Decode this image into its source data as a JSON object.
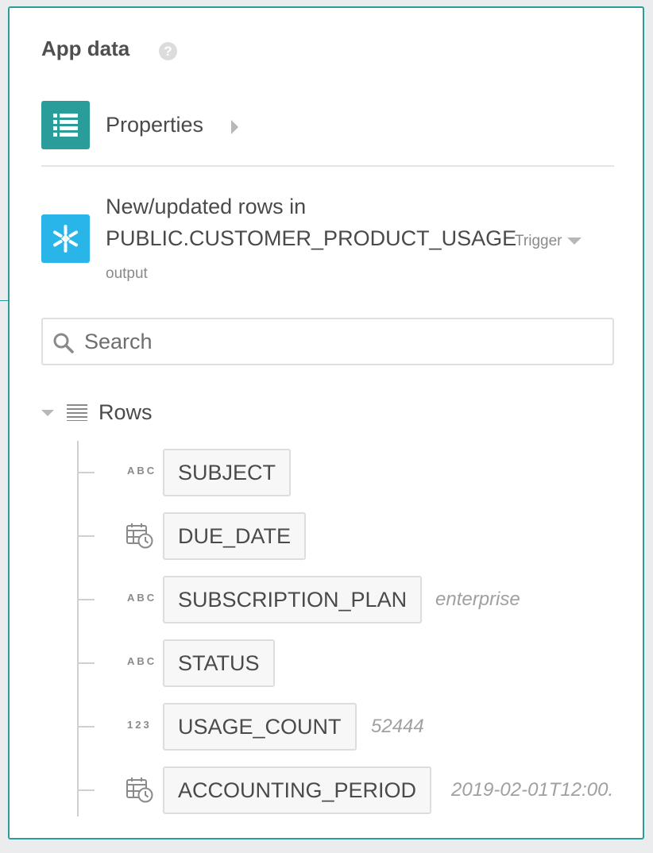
{
  "panel": {
    "title": "App data",
    "help_icon": "question-circle-icon"
  },
  "properties": {
    "icon": "list-icon",
    "label": "Properties",
    "caret_icon": "caret-right-icon"
  },
  "trigger_step": {
    "icon": "snowflake-icon",
    "line1": "New/updated rows in",
    "line2": "PUBLIC.CUSTOMER_PRODUCT_USAGE",
    "badge": "Trigger",
    "badge_icon": "caret-down-icon",
    "sublabel": "output"
  },
  "search": {
    "placeholder": "Search",
    "value": "",
    "icon": "search-icon"
  },
  "rows_group": {
    "label": "Rows",
    "toggle_icon": "caret-down-icon",
    "icon": "list-lines-icon",
    "fields": [
      {
        "type": "ABC",
        "name": "SUBJECT",
        "sample": ""
      },
      {
        "type": "datetime",
        "name": "DUE_DATE",
        "sample": ""
      },
      {
        "type": "ABC",
        "name": "SUBSCRIPTION_PLAN",
        "sample": "enterprise"
      },
      {
        "type": "ABC",
        "name": "STATUS",
        "sample": ""
      },
      {
        "type": "123",
        "name": "USAGE_COUNT",
        "sample": "52444"
      },
      {
        "type": "datetime",
        "name": "ACCOUNTING_PERIOD",
        "sample": "2019-02-01T12:00."
      }
    ]
  },
  "colors": {
    "accent": "#2a9d9a",
    "snowflake": "#29b5e8",
    "text": "#4a4a4a",
    "muted": "#8a8a8a"
  }
}
